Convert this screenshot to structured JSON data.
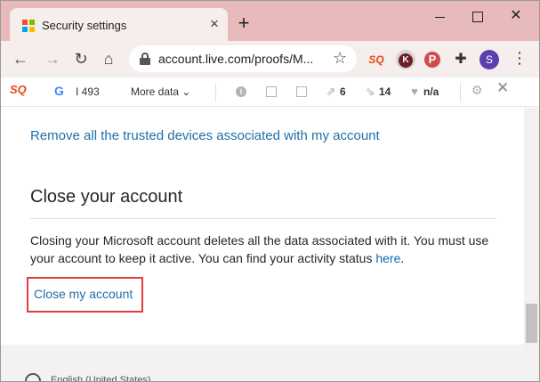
{
  "browser": {
    "tab_title": "Security settings",
    "tab_close": "×",
    "new_tab": "+",
    "window_close": "✕",
    "url": "account.live.com/proofs/M...",
    "profile_initial": "S",
    "ext_k_letter": "K",
    "ext_seoquake": "SQ",
    "menu": "⋮"
  },
  "seoquake_bar": {
    "logo": "SQ",
    "google_icon": "G",
    "google_index": "I 493",
    "more_data": "More data ⌄",
    "links_count": "6",
    "internal_count": "14",
    "rank_value": "n/a"
  },
  "content": {
    "remove_devices_link": "Remove all the trusted devices associated with my account",
    "section_title": "Close your account",
    "description_text": "Closing your Microsoft account deletes all the data associated with it. You must use your account to keep it active. You can find your activity status ",
    "here_link": "here",
    "period": ".",
    "close_account_link": "Close my account",
    "language": "English (United States)"
  },
  "colors": {
    "tabstrip": "#e8babb",
    "toolbar": "#f6eded",
    "link": "#1f6fa9",
    "highlight_border": "#e53b3b"
  }
}
